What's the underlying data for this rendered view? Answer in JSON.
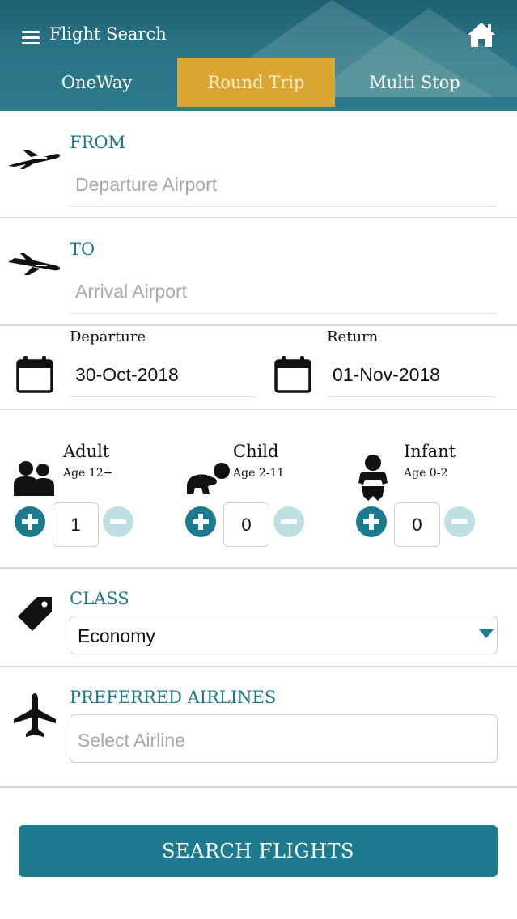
{
  "header": {
    "title": "Flight Search",
    "menu_icon": "hamburger-menu-icon",
    "home_icon": "home-icon"
  },
  "tabs": [
    {
      "label": "OneWay",
      "active": false
    },
    {
      "label": "Round Trip",
      "active": true
    },
    {
      "label": "Multi Stop",
      "active": false
    }
  ],
  "from": {
    "label": "FROM",
    "placeholder": "Departure Airport",
    "icon": "airplane-takeoff-icon"
  },
  "to": {
    "label": "TO",
    "placeholder": "Arrival Airport",
    "icon": "airplane-landing-icon"
  },
  "dates": {
    "departure_label": "Departure",
    "departure_value": "30-Oct-2018",
    "return_label": "Return",
    "return_value": "01-Nov-2018",
    "icon": "calendar-icon"
  },
  "passengers": [
    {
      "label": "Adult",
      "age": "Age 12+",
      "count": "1",
      "icon": "adult-icon"
    },
    {
      "label": "Child",
      "age": "Age 2-11",
      "count": "0",
      "icon": "child-icon"
    },
    {
      "label": "Infant",
      "age": "Age 0-2",
      "count": "0",
      "icon": "infant-icon"
    }
  ],
  "class": {
    "label": "CLASS",
    "selected": "Economy",
    "icon": "tag-icon"
  },
  "airlines": {
    "label": "PREFERRED AIRLINES",
    "placeholder": "Select Airline",
    "icon": "airplane-icon"
  },
  "search_button": "SEARCH FLIGHTS",
  "colors": {
    "accent": "#1b7a8e",
    "tab_active": "#d9a632",
    "header": "#2a7486"
  }
}
